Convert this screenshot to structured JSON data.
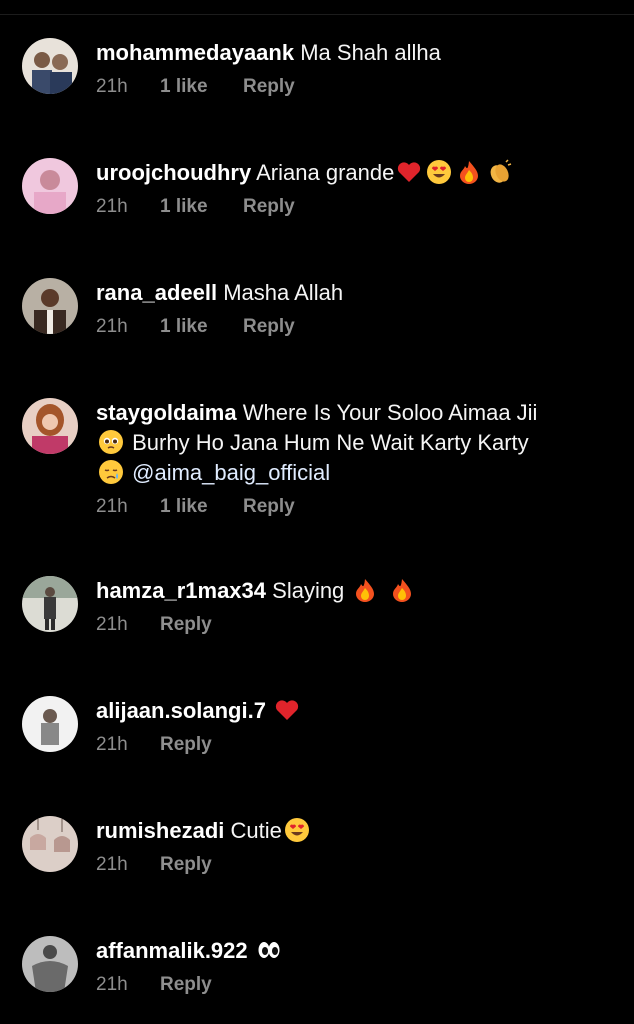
{
  "comments": [
    {
      "username": "mohammedayaank",
      "text": "Ma Shah allha",
      "emojis": [],
      "time": "21h",
      "likes": "1 like",
      "reply": "Reply",
      "avatar_color": "#c9c2b8"
    },
    {
      "username": "uroojchoudhry",
      "text": "Ariana grande",
      "emojis": [
        "red-heart",
        "heart-eyes",
        "fire",
        "clapping-hands"
      ],
      "time": "21h",
      "likes": "1 like",
      "reply": "Reply",
      "avatar_color": "#d9a6c8"
    },
    {
      "username": "rana_adeell",
      "text": "Masha Allah",
      "emojis": [],
      "time": "21h",
      "likes": "1 like",
      "reply": "Reply",
      "avatar_color": "#8a7a6a"
    },
    {
      "username": "staygoldaima",
      "text": "Where Is Your Soloo Aimaa Jii",
      "text2": "Burhy Ho Jana Hum Ne Wait Karty Karty",
      "mention": "@aima_baig_official",
      "emojis": [
        "pleading-face",
        "sad-face"
      ],
      "time": "21h",
      "likes": "1 like",
      "reply": "Reply",
      "avatar_color": "#b85a78"
    },
    {
      "username": "hamza_r1max34",
      "text": "Slaying",
      "emojis": [
        "fire",
        "fire"
      ],
      "time": "21h",
      "likes": "",
      "reply": "Reply",
      "avatar_color": "#d8d8d0"
    },
    {
      "username": "alijaan.solangi.7",
      "text": "",
      "emojis": [
        "red-heart"
      ],
      "time": "21h",
      "likes": "",
      "reply": "Reply",
      "avatar_color": "#e8e8e8"
    },
    {
      "username": "rumishezadi",
      "text": "Cutie",
      "emojis": [
        "heart-eyes"
      ],
      "time": "21h",
      "likes": "",
      "reply": "Reply",
      "avatar_color": "#d7c9c2"
    },
    {
      "username": "affanmalik.922",
      "text": "",
      "emojis": [
        "eyes"
      ],
      "time": "21h",
      "likes": "",
      "reply": "Reply",
      "avatar_color": "#9a9a9a"
    }
  ]
}
